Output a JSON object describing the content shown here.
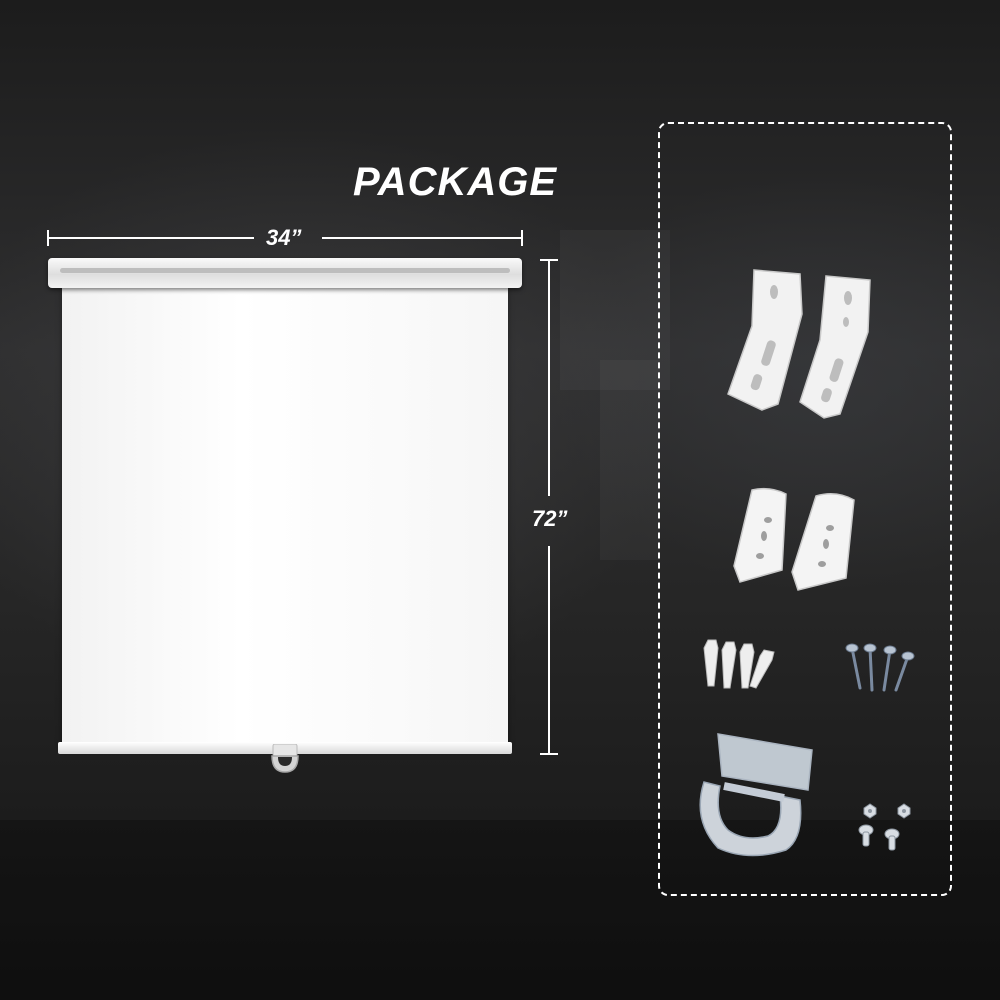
{
  "dimensions": {
    "width_label": "34”",
    "height_label": "72”"
  },
  "package": {
    "title": "PACKAGE"
  },
  "colors": {
    "background": "#2a2a2a",
    "text": "#ffffff",
    "blind": "#f7f7f7"
  },
  "icons": {
    "large_brackets": "large-l-bracket-icon",
    "small_brackets": "small-bracket-icon",
    "anchors": "wall-anchor-icon",
    "screws": "screw-icon",
    "pull_handle": "pull-handle-icon",
    "nuts_bolts": "nut-bolt-icon"
  }
}
